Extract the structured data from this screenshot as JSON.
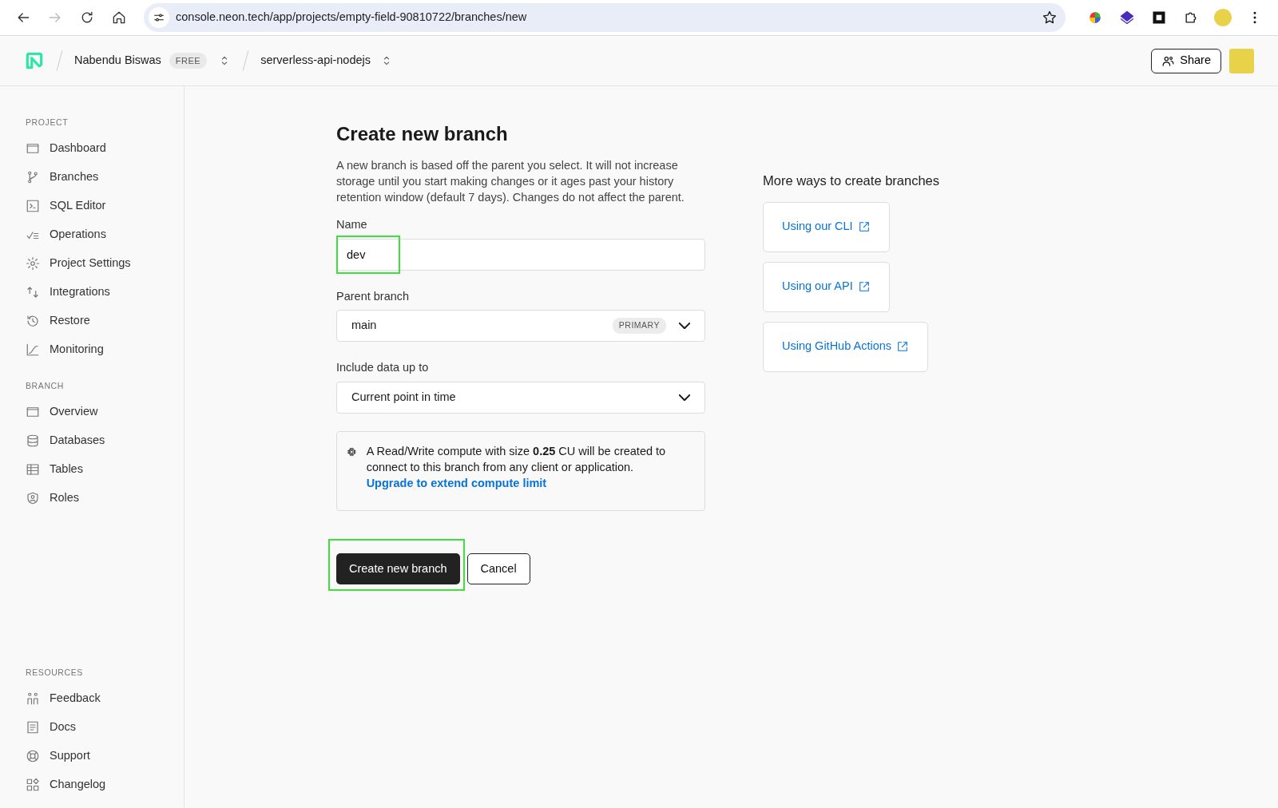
{
  "browser": {
    "url": "console.neon.tech/app/projects/empty-field-90810722/branches/new"
  },
  "header": {
    "org": "Nabendu Biswas",
    "plan": "FREE",
    "project": "serverless-api-nodejs",
    "share": "Share"
  },
  "sidebar": {
    "sections": [
      {
        "title": "PROJECT",
        "items": [
          "Dashboard",
          "Branches",
          "SQL Editor",
          "Operations",
          "Project Settings",
          "Integrations",
          "Restore",
          "Monitoring"
        ]
      },
      {
        "title": "BRANCH",
        "items": [
          "Overview",
          "Databases",
          "Tables",
          "Roles"
        ]
      },
      {
        "title": "RESOURCES",
        "items": [
          "Feedback",
          "Docs",
          "Support",
          "Changelog"
        ]
      }
    ]
  },
  "form": {
    "title": "Create new branch",
    "description": "A new branch is based off the parent you select. It will not increase storage until you start making changes or it ages past your history retention window (default 7 days). Changes do not affect the parent.",
    "name": {
      "label": "Name",
      "value": "dev",
      "highlighted": true
    },
    "parent": {
      "label": "Parent branch",
      "value": "main",
      "badge": "PRIMARY"
    },
    "include": {
      "label": "Include data up to",
      "value": "Current point in time"
    },
    "info": {
      "text": "A Read/Write compute with size **0.25** CU will be created to connect to this branch from any client or application.",
      "link": "Upgrade to extend compute limit"
    },
    "buttons": [
      {
        "label": "Create new branch",
        "kind": "primary",
        "highlighted": true
      },
      {
        "label": "Cancel",
        "kind": "secondary",
        "highlighted": false
      }
    ]
  },
  "more": {
    "title": "More ways to create branches",
    "links": [
      "Using our CLI",
      "Using our API",
      "Using GitHub Actions"
    ]
  }
}
